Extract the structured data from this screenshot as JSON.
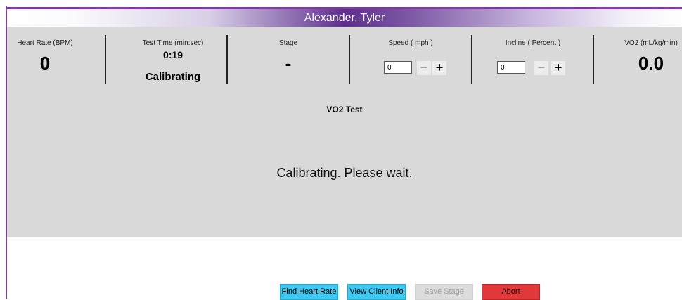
{
  "header": {
    "client_name": "Alexander, Tyler"
  },
  "metrics": {
    "heart_rate": {
      "label": "Heart Rate (BPM)",
      "value": "0"
    },
    "test_time": {
      "label": "Test Time (min:sec)",
      "value": "0:19",
      "status": "Calibrating"
    },
    "stage": {
      "label": "Stage",
      "value": "-"
    },
    "speed": {
      "label": "Speed  ( mph )",
      "input_value": "0",
      "minus": "−",
      "plus": "+"
    },
    "incline": {
      "label": "Incline  ( Percent )",
      "input_value": "0",
      "minus": "−",
      "plus": "+"
    },
    "vo2": {
      "label": "VO2 (mL/kg/min)",
      "value": "0.0"
    }
  },
  "main": {
    "title": "VO2 Test",
    "message": "Calibrating.  Please wait."
  },
  "buttons": {
    "find_heart_rate": "Find Heart Rate",
    "view_client_info": "View Client Info",
    "save_stage": "Save Stage",
    "abort": "Abort"
  },
  "colors": {
    "accent": "#5d2f8c",
    "panel": "#d9d9d9",
    "primary_button": "#3fc9f0",
    "abort_button": "#e23a3a"
  }
}
